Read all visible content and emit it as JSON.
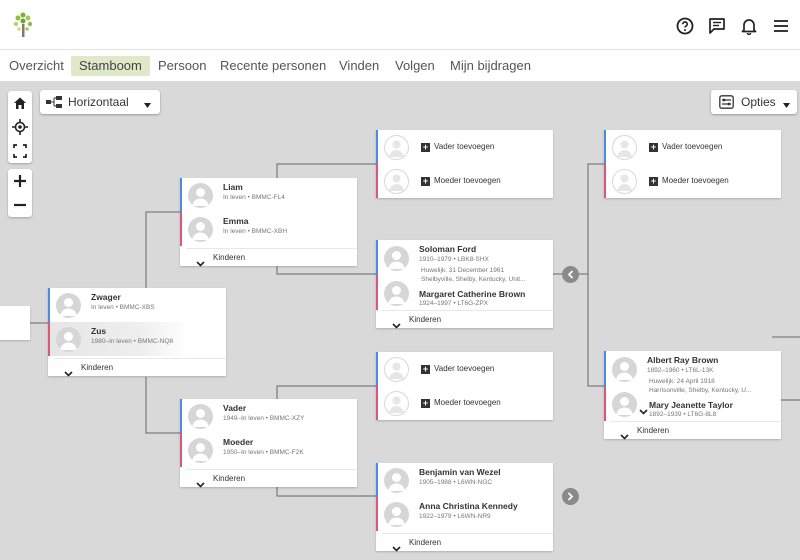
{
  "header": {
    "logo_icon": "family-tree-logo",
    "icons": [
      "help-circle-icon",
      "chat-icon",
      "bell-icon",
      "hamburger-menu-icon"
    ]
  },
  "nav": {
    "tabs": [
      {
        "label": "Overzicht",
        "active": false
      },
      {
        "label": "Stamboom",
        "active": true
      },
      {
        "label": "Persoon",
        "active": false
      },
      {
        "label": "Recente personen",
        "active": false
      },
      {
        "label": "Vinden",
        "active": false
      },
      {
        "label": "Volgen",
        "active": false
      },
      {
        "label": "Mijn bijdragen",
        "active": false
      }
    ]
  },
  "toolbar": {
    "layout_label": "Horizontaal",
    "options_label": "Opties"
  },
  "add_father_label": "Vader toevoegen",
  "add_mother_label": "Moeder toevoegen",
  "children_label": "Kinderen",
  "people": {
    "zwager": {
      "name": "Zwager",
      "info": "In leven • BMMC-XBS"
    },
    "zus": {
      "name": "Zus",
      "info": "1980–In leven • BMMC-NQ8"
    },
    "liam": {
      "name": "Liam",
      "info": "In leven • BMMC-FL4"
    },
    "emma": {
      "name": "Emma",
      "info": "In leven • BMMC-XBH"
    },
    "vader": {
      "name": "Vader",
      "info": "1949–In leven • BMMC-XZY"
    },
    "moeder": {
      "name": "Moeder",
      "info": "1950–In leven • BMMC-F2K"
    },
    "soloman": {
      "name": "Soloman Ford",
      "info": "1910–1979 • LBK8-SHX"
    },
    "margaret": {
      "name": "Margaret Catherine Brown",
      "info": "1924–1997 • LT6G-ZPX"
    },
    "benjamin": {
      "name": "Benjamin van Wezel",
      "info": "1905–1988 • L6WN-NGC"
    },
    "anna": {
      "name": "Anna Christina Kennedy",
      "info": "1922–1979 • L6WN-NR9"
    },
    "albert": {
      "name": "Albert Ray Brown",
      "info": "1892–1960 • LT6L-13K"
    },
    "mary": {
      "name": "Mary Jeanette Taylor",
      "info": "1892–1939 • LT6G-8L8"
    }
  },
  "marriages": {
    "ford": {
      "line1": "Huwelijk: 31 December 1961",
      "line2": "Shelbyville, Shelby, Kentucky, Unit..."
    },
    "brown": {
      "line1": "Huwelijk: 24 April 1918",
      "line2": "Harrisonville, Shelby, Kentucky, U..."
    }
  },
  "colors": {
    "male_bar": "#4a8de0",
    "female_bar": "#d9577c",
    "active_tab_bg": "#dfe8c9",
    "canvas_bg": "#d9d9d9"
  }
}
